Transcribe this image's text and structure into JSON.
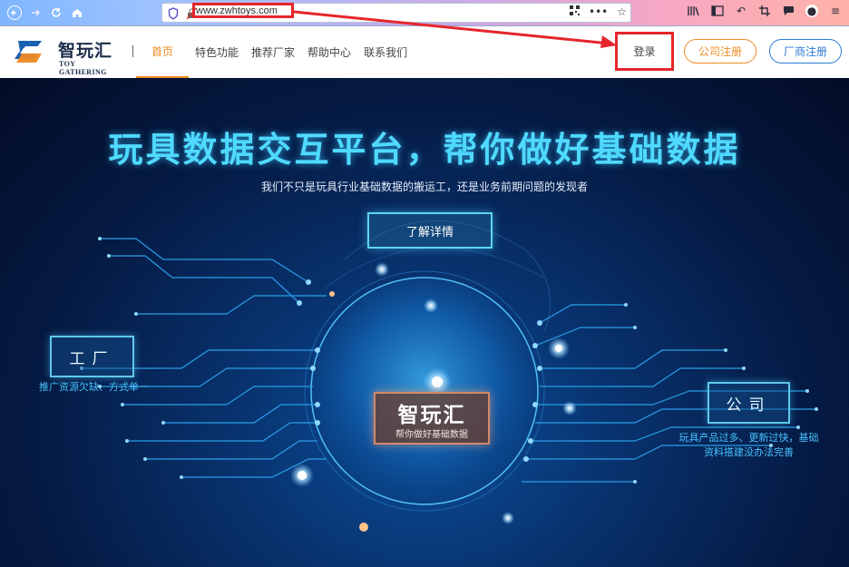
{
  "browser": {
    "url": "www.zwhtoys.com",
    "back_icon": "back-arrow-icon",
    "forward_icon": "forward-arrow-icon",
    "reload_icon": "reload-icon",
    "home_icon": "home-icon"
  },
  "site": {
    "logo_name": "智玩汇",
    "logo_en": "TOY GATHERING",
    "nav": [
      "首页",
      "特色功能",
      "推荐厂家",
      "帮助中心",
      "联系我们"
    ],
    "login_label": "登录",
    "company_register_label": "公司注册",
    "factory_register_label": "厂商注册"
  },
  "hero": {
    "title": "玩具数据交互平台，帮你做好基础数据",
    "subtitle": "我们不只是玩具行业基础数据的搬运工，还是业务前期问题的发现者",
    "learn_more": "了解详情",
    "factory_label": "工厂",
    "factory_caption": "推广资源欠缺、方式单一",
    "company_label": "公司",
    "company_caption_1": "玩具产品过多、更新过快，基础",
    "company_caption_2": "资料搭建没办法完善",
    "center_title": "智玩汇",
    "center_sub": "帮你做好基础数据"
  },
  "colors": {
    "accent_orange": "#f08a24",
    "accent_blue": "#2c7bd6",
    "highlight_red": "#e5262b",
    "hero_cyan": "#4fd9ff"
  }
}
